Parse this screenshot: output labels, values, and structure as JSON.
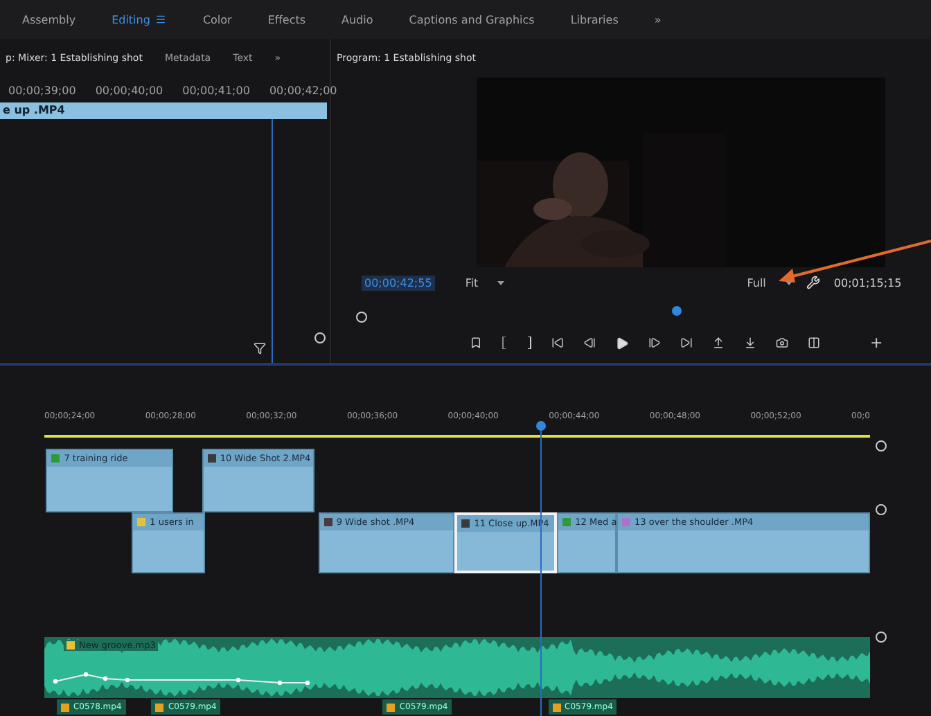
{
  "workspaces": [
    {
      "label": "Assembly",
      "selected": false
    },
    {
      "label": "Editing",
      "selected": true
    },
    {
      "label": "Color",
      "selected": false
    },
    {
      "label": "Effects",
      "selected": false
    },
    {
      "label": "Audio",
      "selected": false
    },
    {
      "label": "Captions and Graphics",
      "selected": false
    },
    {
      "label": "Libraries",
      "selected": false
    }
  ],
  "workspaces_more": "»",
  "source_panel": {
    "tabs": [
      {
        "label": "p: Mixer: 1 Establishing shot",
        "selected": true
      },
      {
        "label": "Metadata",
        "selected": false
      },
      {
        "label": "Text",
        "selected": false
      }
    ],
    "more": "»",
    "ruler": [
      "00;00;39;00",
      "00;00;40;00",
      "00;00;41;00",
      "00;00;42;00"
    ],
    "clip": "e up .MP4"
  },
  "program": {
    "title": "Program: 1 Establishing shot",
    "timecode": "00;00;42;55",
    "zoom": "Fit",
    "resolution": "Full",
    "duration": "00;01;15;15",
    "add": "+"
  },
  "timeline": {
    "ruler": [
      "00;00;24;00",
      "00;00;28;00",
      "00;00;32;00",
      "00;00;36;00",
      "00;00;40;00",
      "00;00;44;00",
      "00;00;48;00",
      "00;00;52;00",
      "00;0"
    ],
    "video_tracks": [
      {
        "clips": [
          {
            "label": "7 training ride",
            "color": "#2f9a3c",
            "selected": false
          },
          {
            "label": "10 Wide Shot 2.MP4",
            "color": "#3a3a3a",
            "selected": false
          }
        ]
      },
      {
        "clips": [
          {
            "label": "1 users in",
            "color": "#e6c23a",
            "selected": false
          },
          {
            "label": "9 Wide shot .MP4",
            "color": "#4a3a3a",
            "selected": false
          },
          {
            "label": "11 Close up.MP4",
            "color": "#3a3a3a",
            "selected": true
          },
          {
            "label": "12 Med a",
            "color": "#2f9a3c",
            "selected": false
          },
          {
            "label": "13 over the shoulder .MP4",
            "color": "#b070c8",
            "selected": false
          }
        ]
      }
    ],
    "audio_clip": "New groove.mp3",
    "audio_clips": [
      "C0578.mp4",
      "C0579.mp4",
      "C0579.mp4",
      "C0579.mp4"
    ]
  }
}
